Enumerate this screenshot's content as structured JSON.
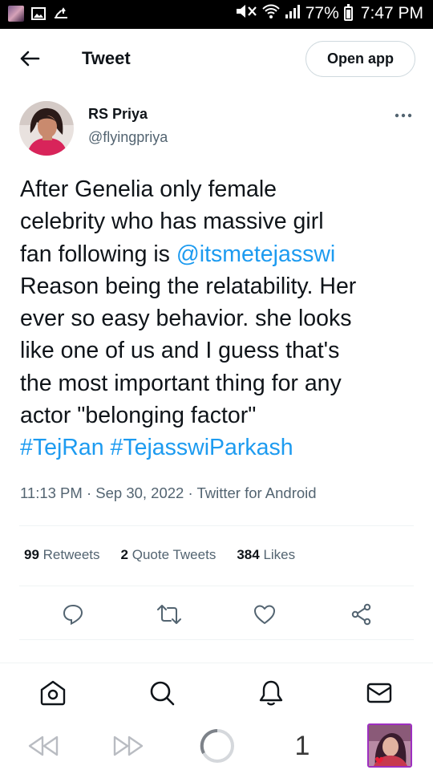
{
  "status_bar": {
    "battery": "77%",
    "time": "7:47 PM"
  },
  "header": {
    "title": "Tweet",
    "open_app_label": "Open app"
  },
  "author": {
    "name": "RS Priya",
    "handle": "@flyingpriya"
  },
  "tweet": {
    "lines": [
      "After Genelia only female",
      "celebrity who has massive girl",
      "fan following is ",
      "Reason being the relatability. Her",
      "ever so easy behavior. she looks",
      "like one of us and I guess that's",
      "the most important thing for any",
      "actor \"belonging factor\""
    ],
    "mention": "@itsmetejasswi",
    "hashtag1": "#TejRan",
    "hashtag2": "#TejasswiParkash",
    "link_color": "#1d9bf0"
  },
  "meta": {
    "time": "11:13 PM",
    "date": "Sep 30, 2022",
    "source": "Twitter for Android",
    "separator": " · "
  },
  "stats": {
    "retweets_count": "99",
    "retweets_label": "Retweets",
    "quotes_count": "2",
    "quotes_label": "Quote Tweets",
    "likes_count": "384",
    "likes_label": "Likes"
  },
  "actions": [
    "reply-icon",
    "retweet-icon",
    "like-icon",
    "share-icon"
  ],
  "bottom_nav": [
    "home-icon",
    "search-icon",
    "notifications-icon",
    "messages-icon"
  ],
  "browser_bar": {
    "tab_count": "1"
  }
}
